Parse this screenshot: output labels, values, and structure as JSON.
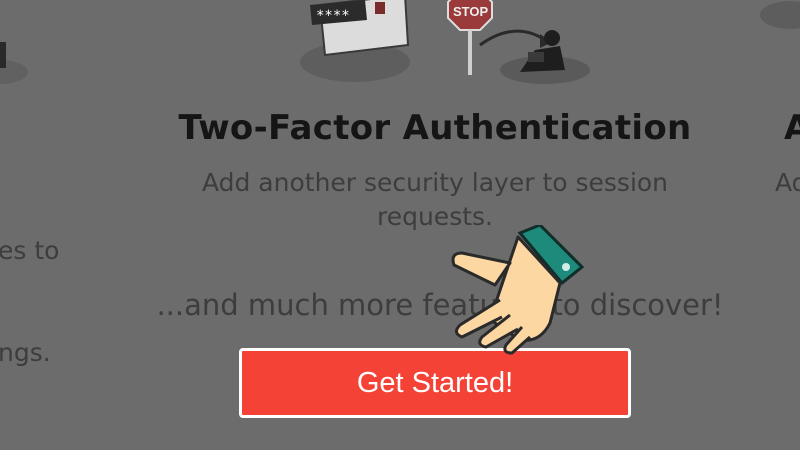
{
  "features": {
    "left_fragment_lines": [
      "es to",
      "ngs."
    ],
    "current": {
      "title": "Two-Factor Authentication",
      "description": "Add another security layer to session requests."
    },
    "right_fragment": {
      "title": "A",
      "description": "Ad"
    }
  },
  "illustration": {
    "sign_text": "STOP",
    "password_mask": "****"
  },
  "more_text": "...and much more features to discover!",
  "cta": {
    "label": "Get Started!"
  },
  "colors": {
    "overlay": "#6c6c6c",
    "button": "#f44236",
    "hand_cuff": "#1d8a7c",
    "hand_skin": "#fcd7a2"
  },
  "icons": {
    "pointer": "pointing-hand-icon"
  }
}
